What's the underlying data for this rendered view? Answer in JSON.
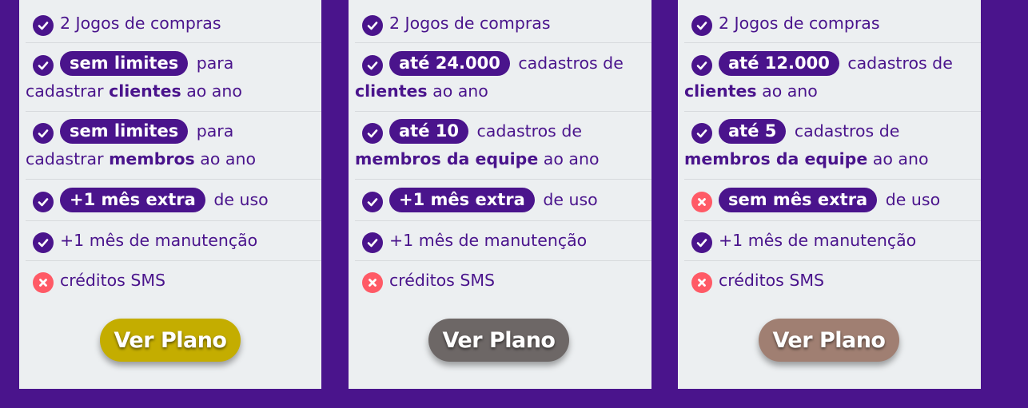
{
  "colors": {
    "background": "#4a148c",
    "card": "#eceff1",
    "text": "#4a148c",
    "check": "#4a148c",
    "cross": "#ff5a66"
  },
  "cards": [
    {
      "button": {
        "label": "Ver Plano",
        "color": "#c4ad00"
      },
      "games": {
        "icon": "check-icon",
        "text": "2 Jogos de compras"
      },
      "clients": {
        "icon": "check-icon",
        "badge": "sem limites",
        "text_after": "para",
        "line2_before": "cadastrar ",
        "bold": "clientes",
        "line2_after": " ao ano"
      },
      "members": {
        "icon": "check-icon",
        "badge": "sem limites",
        "text_after": "para",
        "line2_before": "cadastrar ",
        "bold": "membros",
        "line2_after": " ao ano"
      },
      "extra_month": {
        "icon": "check-icon",
        "badge": "+1 mês extra",
        "text_after": "de uso"
      },
      "maintenance": {
        "icon": "check-icon",
        "text": "+1 mês de manutenção"
      },
      "sms": {
        "icon": "cross-icon",
        "text": "créditos SMS"
      }
    },
    {
      "button": {
        "label": "Ver Plano",
        "color": "#6d6766"
      },
      "games": {
        "icon": "check-icon",
        "text": "2 Jogos de compras"
      },
      "clients": {
        "icon": "check-icon",
        "badge": "até 24.000",
        "text_after": "cadastros de",
        "line2_before": "",
        "bold": "clientes",
        "line2_after": " ao ano"
      },
      "members": {
        "icon": "check-icon",
        "badge": "até 10",
        "text_after": "cadastros de",
        "line2_before": "",
        "bold": "membros da equipe",
        "line2_after": " ao ano"
      },
      "extra_month": {
        "icon": "check-icon",
        "badge": "+1 mês extra",
        "text_after": "de uso"
      },
      "maintenance": {
        "icon": "check-icon",
        "text": "+1 mês de manutenção"
      },
      "sms": {
        "icon": "cross-icon",
        "text": "créditos SMS"
      }
    },
    {
      "button": {
        "label": "Ver Plano",
        "color": "#a07f72"
      },
      "games": {
        "icon": "check-icon",
        "text": "2 Jogos de compras"
      },
      "clients": {
        "icon": "check-icon",
        "badge": "até 12.000",
        "text_after": "cadastros de",
        "line2_before": "",
        "bold": "clientes",
        "line2_after": " ao ano"
      },
      "members": {
        "icon": "check-icon",
        "badge": "até 5",
        "text_after": "cadastros de",
        "line2_before": "",
        "bold": "membros da equipe",
        "line2_after": " ao ano"
      },
      "extra_month": {
        "icon": "cross-icon",
        "badge": "sem mês extra",
        "text_after": "de uso"
      },
      "maintenance": {
        "icon": "check-icon",
        "text": "+1 mês de manutenção"
      },
      "sms": {
        "icon": "cross-icon",
        "text": "créditos SMS"
      }
    }
  ]
}
